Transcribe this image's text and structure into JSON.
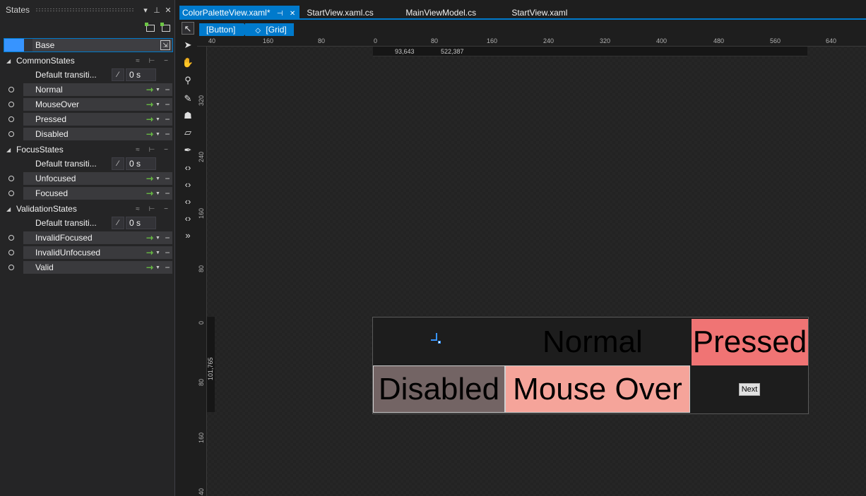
{
  "states_panel": {
    "title": "States",
    "base_label": "Base",
    "groups": [
      {
        "name": "CommonStates",
        "transition_label": "Default transiti...",
        "duration": "0 s",
        "states": [
          "Normal",
          "MouseOver",
          "Pressed",
          "Disabled"
        ]
      },
      {
        "name": "FocusStates",
        "transition_label": "Default transiti...",
        "duration": "0 s",
        "states": [
          "Unfocused",
          "Focused"
        ]
      },
      {
        "name": "ValidationStates",
        "transition_label": "Default transiti...",
        "duration": "0 s",
        "states": [
          "InvalidFocused",
          "InvalidUnfocused",
          "Valid"
        ]
      }
    ]
  },
  "tabs": [
    {
      "label": "ColorPaletteView.xaml*",
      "active": true
    },
    {
      "label": "StartView.xaml.cs",
      "active": false
    },
    {
      "label": "MainViewModel.cs",
      "active": false
    },
    {
      "label": "StartView.xaml",
      "active": false
    }
  ],
  "breadcrumb": [
    "[Button]",
    "[Grid]"
  ],
  "ruler": {
    "top_ticks": [
      "40",
      "160",
      "80",
      "0",
      "80",
      "160",
      "240",
      "320",
      "400",
      "480",
      "560",
      "640"
    ],
    "left_ticks": [
      "320",
      "240",
      "160",
      "80",
      "0",
      "80",
      "160",
      "40"
    ],
    "sub_readout_1": "93,643",
    "sub_readout_2": "522,387",
    "side_readout": "101,765"
  },
  "canvas": {
    "normal": "Normal",
    "pressed": "Pressed",
    "disabled": "Disabled",
    "mouse_over": "Mouse Over",
    "next": "Next"
  },
  "colors": {
    "accent": "#007acc",
    "pressed": "#f07474",
    "disabled": "#736464",
    "mouse_over": "#f5a49a"
  }
}
